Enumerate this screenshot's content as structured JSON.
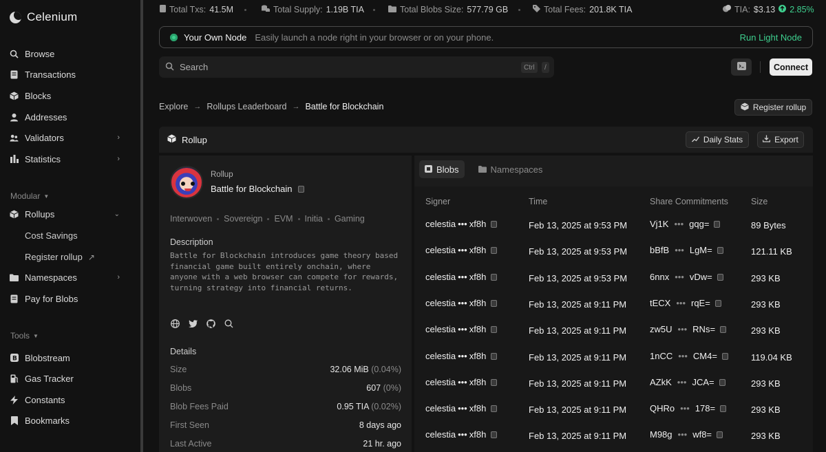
{
  "app": {
    "name": "Celenium"
  },
  "sidebar": {
    "main": [
      {
        "label": "Browse",
        "icon": "search-icon",
        "glyph": "○"
      },
      {
        "label": "Transactions",
        "icon": "document-icon",
        "glyph": "▤"
      },
      {
        "label": "Blocks",
        "icon": "cube-icon",
        "glyph": "◆"
      },
      {
        "label": "Addresses",
        "icon": "user-icon",
        "glyph": "●"
      },
      {
        "label": "Validators",
        "icon": "validators-icon",
        "glyph": "◈"
      },
      {
        "label": "Statistics",
        "icon": "chart-icon",
        "glyph": "▮"
      }
    ],
    "modular_label": "Modular",
    "modular": [
      {
        "label": "Rollups",
        "icon": "rollups-icon",
        "glyph": "◆"
      },
      {
        "label": "Cost Savings"
      },
      {
        "label": "Register rollup"
      },
      {
        "label": "Namespaces",
        "icon": "folder-icon",
        "glyph": "▬"
      },
      {
        "label": "Pay for Blobs",
        "icon": "document-icon",
        "glyph": "▤"
      }
    ],
    "tools_label": "Tools",
    "tools": [
      {
        "label": "Blobstream",
        "icon": "blobstream-icon",
        "glyph": "B"
      },
      {
        "label": "Gas Tracker",
        "icon": "gas-icon",
        "glyph": "▟"
      },
      {
        "label": "Constants",
        "icon": "bolt-icon",
        "glyph": "ϟ"
      },
      {
        "label": "Bookmarks",
        "icon": "bookmark-icon",
        "glyph": "▮"
      }
    ]
  },
  "stats": {
    "total_txs_label": "Total Txs:",
    "total_txs": "41.5M",
    "total_supply_label": "Total Supply:",
    "total_supply": "1.19B TIA",
    "total_blobs_label": "Total Blobs Size:",
    "total_blobs": "577.79 GB",
    "total_fees_label": "Total Fees:",
    "total_fees": "201.8K TIA",
    "tia_label": "TIA:",
    "tia_price": "$3.13",
    "tia_change": "2.85%"
  },
  "node_banner": {
    "title": "Your Own Node",
    "description": "Easily launch a node right in your browser or on your phone.",
    "link": "Run Light Node"
  },
  "search": {
    "placeholder": "Search",
    "kbd1": "Ctrl",
    "kbd2": "/"
  },
  "header": {
    "connect": "Connect"
  },
  "breadcrumb": {
    "items": [
      "Explore",
      "Rollups Leaderboard",
      "Battle for Blockchain"
    ]
  },
  "register_button": "Register rollup",
  "panel": {
    "title": "Rollup",
    "daily_stats": "Daily Stats",
    "export": "Export"
  },
  "rollup": {
    "kicker": "Rollup",
    "name": "Battle for Blockchain",
    "tags": [
      "Interwoven",
      "Sovereign",
      "EVM",
      "Initia",
      "Gaming"
    ],
    "description_label": "Description",
    "description": "Battle for Blockchain introduces game theory based financial game built entirely onchain, where anyone with a web browser can compete for rewards, turning strategy into financial returns.",
    "details_label": "Details",
    "details": [
      {
        "key": "Size",
        "value": "32.06 MiB",
        "extra": "(0.04%)"
      },
      {
        "key": "Blobs",
        "value": "607",
        "extra": "(0%)"
      },
      {
        "key": "Blob Fees Paid",
        "value": "0.95 TIA",
        "extra": "(0.02%)"
      },
      {
        "key": "First Seen",
        "value": "8 days ago",
        "extra": ""
      },
      {
        "key": "Last Active",
        "value": "21 hr. ago",
        "extra": ""
      }
    ]
  },
  "tabs": {
    "blobs": "Blobs",
    "namespaces": "Namespaces"
  },
  "table": {
    "headers": [
      "Signer",
      "Time",
      "Share Commitments",
      "Size"
    ],
    "rows": [
      {
        "signer_a": "celestia",
        "signer_b": "xf8h",
        "time": "Feb 13, 2025 at 9:53 PM",
        "sc_a": "Vj1K",
        "sc_b": "gqg=",
        "size": "89 Bytes"
      },
      {
        "signer_a": "celestia",
        "signer_b": "xf8h",
        "time": "Feb 13, 2025 at 9:53 PM",
        "sc_a": "bBfB",
        "sc_b": "LgM=",
        "size": "121.11 KB"
      },
      {
        "signer_a": "celestia",
        "signer_b": "xf8h",
        "time": "Feb 13, 2025 at 9:53 PM",
        "sc_a": "6nnx",
        "sc_b": "vDw=",
        "size": "293 KB"
      },
      {
        "signer_a": "celestia",
        "signer_b": "xf8h",
        "time": "Feb 13, 2025 at 9:11 PM",
        "sc_a": "tECX",
        "sc_b": "rqE=",
        "size": "293 KB"
      },
      {
        "signer_a": "celestia",
        "signer_b": "xf8h",
        "time": "Feb 13, 2025 at 9:11 PM",
        "sc_a": "zw5U",
        "sc_b": "RNs=",
        "size": "293 KB"
      },
      {
        "signer_a": "celestia",
        "signer_b": "xf8h",
        "time": "Feb 13, 2025 at 9:11 PM",
        "sc_a": "1nCC",
        "sc_b": "CM4=",
        "size": "119.04 KB"
      },
      {
        "signer_a": "celestia",
        "signer_b": "xf8h",
        "time": "Feb 13, 2025 at 9:11 PM",
        "sc_a": "AZkK",
        "sc_b": "JCA=",
        "size": "293 KB"
      },
      {
        "signer_a": "celestia",
        "signer_b": "xf8h",
        "time": "Feb 13, 2025 at 9:11 PM",
        "sc_a": "QHRo",
        "sc_b": "178=",
        "size": "293 KB"
      },
      {
        "signer_a": "celestia",
        "signer_b": "xf8h",
        "time": "Feb 13, 2025 at 9:11 PM",
        "sc_a": "M98g",
        "sc_b": "wf8=",
        "size": "293 KB"
      }
    ]
  },
  "colors": {
    "accent": "#3ecf8e",
    "background": "#121212",
    "panel": "#1c1c1c"
  }
}
